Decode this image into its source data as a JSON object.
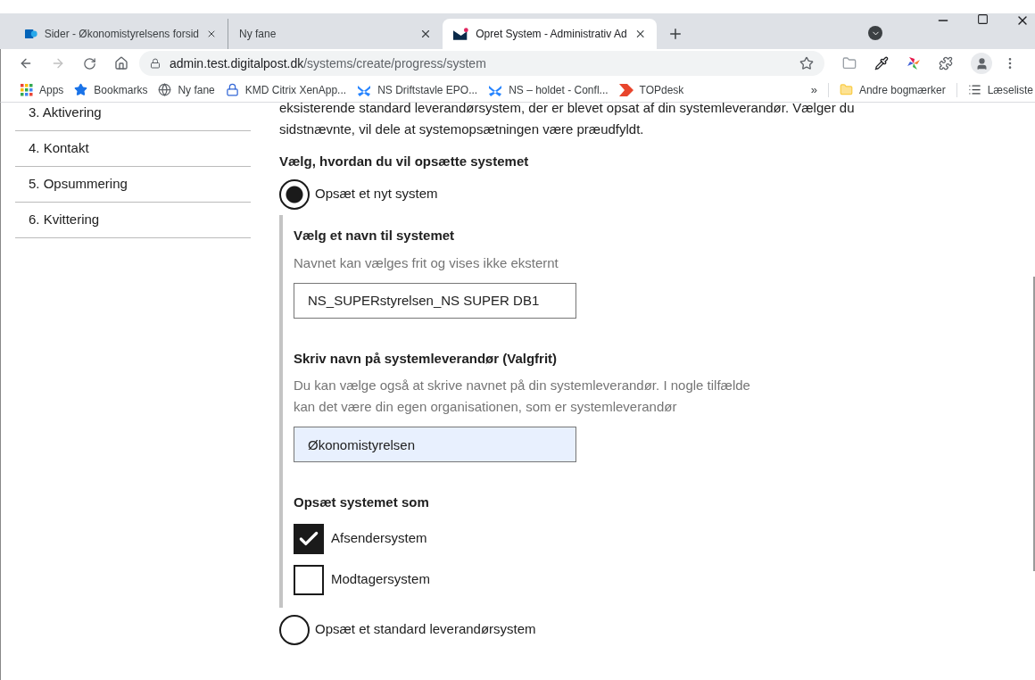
{
  "browser": {
    "tabs": [
      {
        "title": "Sider - Økonomistyrelsens forsid",
        "selected": false
      },
      {
        "title": "Ny fane",
        "selected": false
      },
      {
        "title": "Opret System - Administrativ Ad",
        "selected": true
      }
    ],
    "url_host": "admin.test.digitalpost.dk",
    "url_path": "/systems/create/progress/system",
    "bookmarks": [
      "Apps",
      "Bookmarks",
      "Ny fane",
      "KMD Citrix XenApp...",
      "NS Driftstavle EPO...",
      "NS – holdet - Confl...",
      "TOPdesk"
    ],
    "overflow": "»",
    "other_bookmarks": "Andre bogmærker",
    "reading_list": "Læseliste"
  },
  "sidebar": {
    "items": [
      "3. Aktivering",
      "4. Kontakt",
      "5. Opsummering",
      "6. Kvittering"
    ]
  },
  "intro_lines": [
    "eksisterende standard leverandørsystem, der er blevet opsat af din systemleverandør. Vælger du",
    "sidstnævnte, vil dele at systemopsætningen være præudfyldt."
  ],
  "choice_label": "Vælg, hvordan du vil opsætte systemet",
  "options": [
    {
      "label": "Opsæt et nyt system",
      "selected": true
    },
    {
      "label": "Opsæt et standard leverandørsystem",
      "selected": false
    }
  ],
  "name_field": {
    "label": "Vælg et navn til systemet",
    "help": "Navnet kan vælges frit og vises ikke eksternt",
    "value": "NS_SUPERstyrelsen_NS SUPER DB1",
    "autofilled": false
  },
  "vendor_field": {
    "label": "Skriv navn på systemleverandør (Valgfrit)",
    "help_lines": [
      "Du kan vælge også at skrive navnet på din systemleverandør. I nogle tilfælde",
      "kan det være din egen organisationen, som er systemleverandør"
    ],
    "value": "Økonomistyrelsen",
    "autofilled": true
  },
  "roles": {
    "label": "Opsæt systemet som",
    "items": [
      {
        "label": "Afsendersystem",
        "checked": true
      },
      {
        "label": "Modtagersystem",
        "checked": false
      }
    ]
  }
}
